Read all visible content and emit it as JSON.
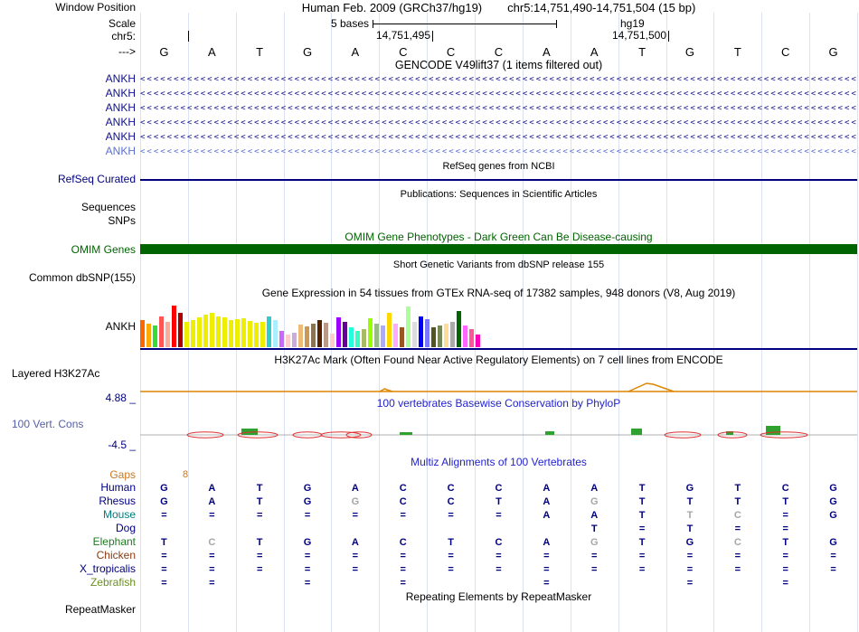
{
  "header": {
    "assembly_title": "Human Feb. 2009 (GRCh37/hg19)",
    "position_title": "chr5:14,751,490-14,751,504 (15 bp)",
    "window_position_label": "Window Position",
    "scale_label": "Scale",
    "scale_value": "5 bases",
    "scale_assembly": "hg19",
    "chrom_label": "chr5:",
    "coord_mid": "14,751,495",
    "coord_right": "14,751,500",
    "strand_label": "--->"
  },
  "bases": [
    "G",
    "A",
    "T",
    "G",
    "A",
    "C",
    "C",
    "C",
    "A",
    "A",
    "T",
    "G",
    "T",
    "C",
    "G"
  ],
  "colors": {
    "gridline": "#dce2f2",
    "navy": "#000080",
    "title_blue": "#2222CC",
    "omim_green": "#006400",
    "gaps_orange": "#C87820",
    "h3k27ac_orange": "#DD8500",
    "phylop_label": "#5560A8",
    "letter_navy": "#000080",
    "dim_letter": "#A6A6A6"
  },
  "tracks": {
    "gencode": {
      "title": "GENCODE V49lift37 (1 items filtered out)",
      "genes": [
        {
          "label": "ANKH",
          "color": "#10108A"
        },
        {
          "label": "ANKH",
          "color": "#10108A"
        },
        {
          "label": "ANKH",
          "color": "#10108A"
        },
        {
          "label": "ANKH",
          "color": "#10108A"
        },
        {
          "label": "ANKH",
          "color": "#10108A"
        },
        {
          "label": "ANKH",
          "color": "#5B6FD0"
        }
      ]
    },
    "refseq": {
      "title": "RefSeq genes from NCBI",
      "label": "RefSeq Curated",
      "color": "#000080"
    },
    "publications": {
      "title": "Publications: Sequences in Scientific Articles",
      "row_labels": [
        "Sequences",
        "SNPs"
      ]
    },
    "omim": {
      "title": "OMIM Gene Phenotypes - Dark Green Can Be Disease-causing",
      "label": "OMIM Genes",
      "color": "#006400"
    },
    "dbsnp": {
      "title": "Short Genetic Variants from dbSNP release 155",
      "label": "Common dbSNP(155)"
    },
    "gtex": {
      "title": "Gene Expression in 54 tissues from GTEx RNA-seq of 17382 samples, 948 donors (V8, Aug 2019)",
      "label": "ANKH"
    },
    "h3k27ac": {
      "title": "H3K27Ac Mark (Often Found Near Active Regulatory Elements) on 7 cell lines from ENCODE",
      "label": "Layered H3K27Ac",
      "signal": {
        "color": "#DD8500",
        "baseline_y": 13,
        "bumps": [
          [
            265,
            14,
            3
          ],
          [
            540,
            50,
            9
          ]
        ]
      }
    },
    "phylop": {
      "title": "100 vertebrates Basewise Conservation by PhyloP",
      "label": "100 Vert. Cons",
      "max_label": "4.88 _",
      "min_label": "-4.5 _",
      "marks": {
        "baseline_color": "#999999",
        "green": [
          [
            112,
            18,
            7
          ],
          [
            287,
            14,
            3
          ],
          [
            448,
            10,
            4
          ],
          [
            543,
            12,
            7
          ],
          [
            648,
            8,
            4
          ],
          [
            692,
            16,
            10
          ]
        ],
        "red_arcs": [
          [
            72,
            20
          ],
          [
            130,
            22
          ],
          [
            185,
            16
          ],
          [
            222,
            22
          ],
          [
            242,
            14
          ],
          [
            600,
            20
          ],
          [
            655,
            16
          ],
          [
            712,
            26
          ]
        ]
      }
    },
    "multiz": {
      "title": "Multiz Alignments of 100 Vertebrates",
      "gaps": {
        "label": "Gaps",
        "value": "8"
      },
      "rows": [
        {
          "name": "Human",
          "color": "#000080",
          "seq": [
            "G",
            "A",
            "T",
            "G",
            "A",
            "C",
            "C",
            "C",
            "A",
            "A",
            "T",
            "G",
            "T",
            "C",
            "G"
          ],
          "dim": []
        },
        {
          "name": "Rhesus",
          "color": "#000080",
          "seq": [
            "G",
            "A",
            "T",
            "G",
            "G",
            "C",
            "C",
            "T",
            "A",
            "G",
            "T",
            "T",
            "T",
            "T",
            "G"
          ],
          "dim": [
            4,
            9
          ]
        },
        {
          "name": "Mouse",
          "color": "#007C7C",
          "seq": [
            "=",
            "=",
            "=",
            "=",
            "=",
            "=",
            "=",
            "=",
            "A",
            "A",
            "T",
            "T",
            "C",
            "=",
            "G"
          ],
          "dim": [
            11,
            12
          ]
        },
        {
          "name": "Dog",
          "color": "#000080",
          "seq": [
            "",
            "",
            "",
            "",
            "",
            "",
            "",
            "",
            "",
            "T",
            "=",
            "T",
            "=",
            "=",
            ""
          ],
          "dim": []
        },
        {
          "name": "Elephant",
          "color": "#1E7C1E",
          "seq": [
            "T",
            "C",
            "T",
            "G",
            "A",
            "C",
            "T",
            "C",
            "A",
            "G",
            "T",
            "G",
            "C",
            "T",
            "G"
          ],
          "dim": [
            1,
            9,
            12
          ]
        },
        {
          "name": "Chicken",
          "color": "#8B3A10",
          "seq": [
            "=",
            "=",
            "=",
            "=",
            "=",
            "=",
            "=",
            "=",
            "=",
            "=",
            "=",
            "=",
            "=",
            "=",
            "="
          ],
          "dim": []
        },
        {
          "name": "X_tropicalis",
          "color": "#000080",
          "seq": [
            "=",
            "=",
            "=",
            "=",
            "=",
            "=",
            "=",
            "=",
            "=",
            "=",
            "=",
            "=",
            "=",
            "=",
            "="
          ],
          "dim": []
        },
        {
          "name": "Zebrafish",
          "color": "#6B8E23",
          "seq": [
            "=",
            "=",
            "",
            "=",
            "",
            "=",
            "",
            "",
            "=",
            "",
            "",
            "=",
            "",
            "=",
            ""
          ],
          "dim": []
        }
      ]
    },
    "repeatmasker": {
      "title": "Repeating Elements by RepeatMasker",
      "label": "RepeatMasker"
    }
  },
  "chart_data": {
    "type": "bar",
    "title": "Gene Expression in 54 tissues from GTEx RNA-seq of 17382 samples, 948 donors (V8, Aug 2019)",
    "series_label": "ANKH",
    "n_categories": 54,
    "values": [
      30,
      26,
      24,
      34,
      28,
      46,
      38,
      28,
      30,
      33,
      36,
      38,
      34,
      33,
      30,
      31,
      32,
      29,
      27,
      28,
      34,
      30,
      18,
      14,
      16,
      25,
      23,
      26,
      30,
      27,
      15,
      33,
      28,
      22,
      18,
      20,
      32,
      26,
      24,
      38,
      26,
      22,
      45,
      28,
      34,
      31,
      22,
      24,
      26,
      28,
      40,
      24,
      20,
      14
    ],
    "colors": [
      "#FF6600",
      "#FFAA00",
      "#33DD33",
      "#FF5555",
      "#FFAA99",
      "#FF0000",
      "#AA0000",
      "#EEEE00",
      "#EEEE00",
      "#EEEE00",
      "#EEEE00",
      "#EEEE00",
      "#EEEE00",
      "#EEEE00",
      "#EEEE00",
      "#EEEE00",
      "#EEEE00",
      "#EEEE00",
      "#EEEE00",
      "#EEEE00",
      "#33CCCC",
      "#AAEEFF",
      "#CC66FF",
      "#FFCCCC",
      "#CCAADD",
      "#EEBB77",
      "#CC9955",
      "#8B7355",
      "#552200",
      "#BB9988",
      "#FFCCCC",
      "#9900FF",
      "#660099",
      "#22FFDD",
      "#33FFC2",
      "#AABB66",
      "#99FF00",
      "#99BB88",
      "#AAAAFF",
      "#FFD700",
      "#FFAAFF",
      "#995522",
      "#AAFF99",
      "#DDDDDD",
      "#0000FF",
      "#7777FF",
      "#555522",
      "#778855",
      "#FFDD99",
      "#AAAAAA",
      "#006600",
      "#FF66FF",
      "#FF5599",
      "#FF00BB"
    ],
    "ylim": [
      0,
      50
    ]
  }
}
